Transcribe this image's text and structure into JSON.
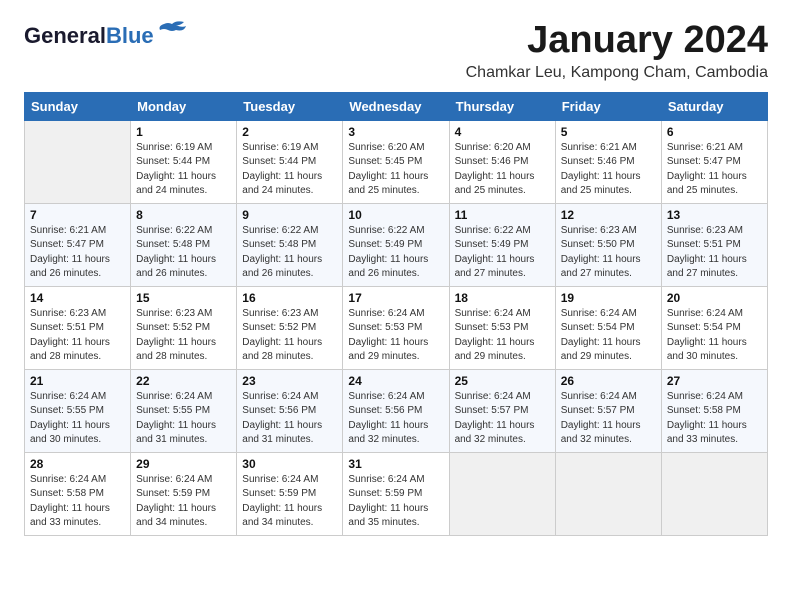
{
  "header": {
    "logo_line1": "General",
    "logo_line2": "Blue",
    "month_title": "January 2024",
    "location": "Chamkar Leu, Kampong Cham, Cambodia"
  },
  "weekdays": [
    "Sunday",
    "Monday",
    "Tuesday",
    "Wednesday",
    "Thursday",
    "Friday",
    "Saturday"
  ],
  "weeks": [
    [
      {
        "day": "",
        "empty": true
      },
      {
        "day": "1",
        "sunrise": "6:19 AM",
        "sunset": "5:44 PM",
        "daylight": "11 hours and 24 minutes."
      },
      {
        "day": "2",
        "sunrise": "6:19 AM",
        "sunset": "5:44 PM",
        "daylight": "11 hours and 24 minutes."
      },
      {
        "day": "3",
        "sunrise": "6:20 AM",
        "sunset": "5:45 PM",
        "daylight": "11 hours and 25 minutes."
      },
      {
        "day": "4",
        "sunrise": "6:20 AM",
        "sunset": "5:46 PM",
        "daylight": "11 hours and 25 minutes."
      },
      {
        "day": "5",
        "sunrise": "6:21 AM",
        "sunset": "5:46 PM",
        "daylight": "11 hours and 25 minutes."
      },
      {
        "day": "6",
        "sunrise": "6:21 AM",
        "sunset": "5:47 PM",
        "daylight": "11 hours and 25 minutes."
      }
    ],
    [
      {
        "day": "7",
        "sunrise": "6:21 AM",
        "sunset": "5:47 PM",
        "daylight": "11 hours and 26 minutes."
      },
      {
        "day": "8",
        "sunrise": "6:22 AM",
        "sunset": "5:48 PM",
        "daylight": "11 hours and 26 minutes."
      },
      {
        "day": "9",
        "sunrise": "6:22 AM",
        "sunset": "5:48 PM",
        "daylight": "11 hours and 26 minutes."
      },
      {
        "day": "10",
        "sunrise": "6:22 AM",
        "sunset": "5:49 PM",
        "daylight": "11 hours and 26 minutes."
      },
      {
        "day": "11",
        "sunrise": "6:22 AM",
        "sunset": "5:49 PM",
        "daylight": "11 hours and 27 minutes."
      },
      {
        "day": "12",
        "sunrise": "6:23 AM",
        "sunset": "5:50 PM",
        "daylight": "11 hours and 27 minutes."
      },
      {
        "day": "13",
        "sunrise": "6:23 AM",
        "sunset": "5:51 PM",
        "daylight": "11 hours and 27 minutes."
      }
    ],
    [
      {
        "day": "14",
        "sunrise": "6:23 AM",
        "sunset": "5:51 PM",
        "daylight": "11 hours and 28 minutes."
      },
      {
        "day": "15",
        "sunrise": "6:23 AM",
        "sunset": "5:52 PM",
        "daylight": "11 hours and 28 minutes."
      },
      {
        "day": "16",
        "sunrise": "6:23 AM",
        "sunset": "5:52 PM",
        "daylight": "11 hours and 28 minutes."
      },
      {
        "day": "17",
        "sunrise": "6:24 AM",
        "sunset": "5:53 PM",
        "daylight": "11 hours and 29 minutes."
      },
      {
        "day": "18",
        "sunrise": "6:24 AM",
        "sunset": "5:53 PM",
        "daylight": "11 hours and 29 minutes."
      },
      {
        "day": "19",
        "sunrise": "6:24 AM",
        "sunset": "5:54 PM",
        "daylight": "11 hours and 29 minutes."
      },
      {
        "day": "20",
        "sunrise": "6:24 AM",
        "sunset": "5:54 PM",
        "daylight": "11 hours and 30 minutes."
      }
    ],
    [
      {
        "day": "21",
        "sunrise": "6:24 AM",
        "sunset": "5:55 PM",
        "daylight": "11 hours and 30 minutes."
      },
      {
        "day": "22",
        "sunrise": "6:24 AM",
        "sunset": "5:55 PM",
        "daylight": "11 hours and 31 minutes."
      },
      {
        "day": "23",
        "sunrise": "6:24 AM",
        "sunset": "5:56 PM",
        "daylight": "11 hours and 31 minutes."
      },
      {
        "day": "24",
        "sunrise": "6:24 AM",
        "sunset": "5:56 PM",
        "daylight": "11 hours and 32 minutes."
      },
      {
        "day": "25",
        "sunrise": "6:24 AM",
        "sunset": "5:57 PM",
        "daylight": "11 hours and 32 minutes."
      },
      {
        "day": "26",
        "sunrise": "6:24 AM",
        "sunset": "5:57 PM",
        "daylight": "11 hours and 32 minutes."
      },
      {
        "day": "27",
        "sunrise": "6:24 AM",
        "sunset": "5:58 PM",
        "daylight": "11 hours and 33 minutes."
      }
    ],
    [
      {
        "day": "28",
        "sunrise": "6:24 AM",
        "sunset": "5:58 PM",
        "daylight": "11 hours and 33 minutes."
      },
      {
        "day": "29",
        "sunrise": "6:24 AM",
        "sunset": "5:59 PM",
        "daylight": "11 hours and 34 minutes."
      },
      {
        "day": "30",
        "sunrise": "6:24 AM",
        "sunset": "5:59 PM",
        "daylight": "11 hours and 34 minutes."
      },
      {
        "day": "31",
        "sunrise": "6:24 AM",
        "sunset": "5:59 PM",
        "daylight": "11 hours and 35 minutes."
      },
      {
        "day": "",
        "empty": true
      },
      {
        "day": "",
        "empty": true
      },
      {
        "day": "",
        "empty": true
      }
    ]
  ],
  "labels": {
    "sunrise_prefix": "Sunrise: ",
    "sunset_prefix": "Sunset: ",
    "daylight_prefix": "Daylight: "
  }
}
